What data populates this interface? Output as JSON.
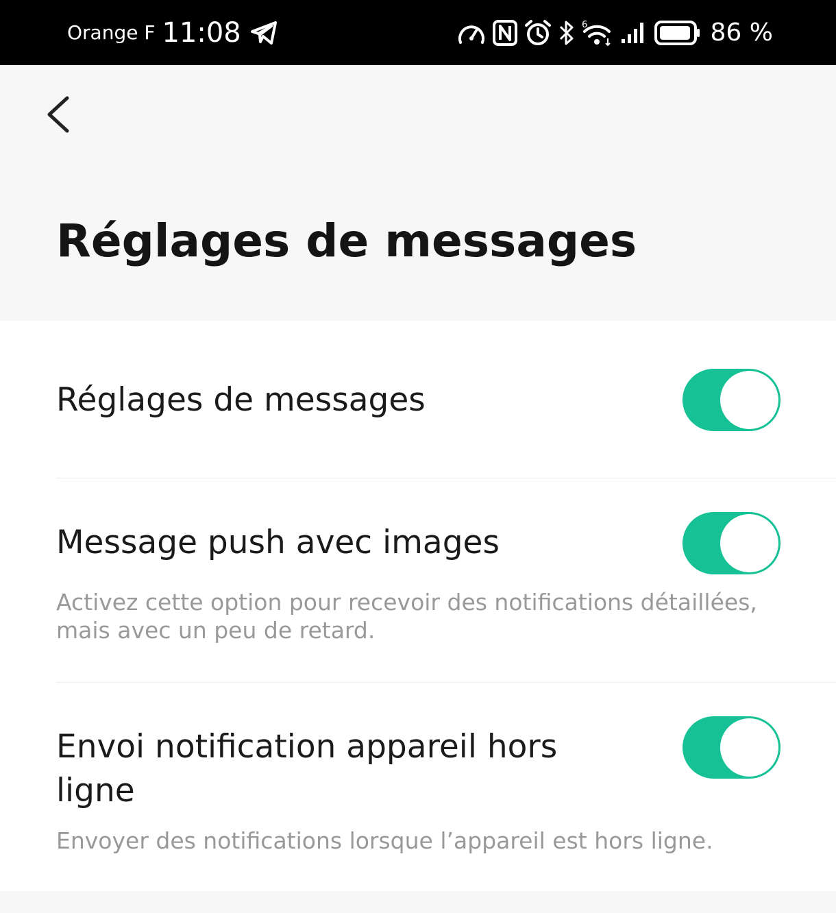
{
  "status_bar": {
    "carrier": "Orange F",
    "time": "11:08",
    "battery_percent": "86 %",
    "icons": [
      "telegram-icon",
      "speedometer-icon",
      "nfc-icon",
      "alarm-icon",
      "bluetooth-icon",
      "wifi-6-icon",
      "signal-icon",
      "battery-icon"
    ]
  },
  "header": {
    "back_icon": "chevron-left-icon",
    "title": "Réglages de messages"
  },
  "settings": [
    {
      "title": "Réglages de messages",
      "description": "",
      "enabled": true
    },
    {
      "title": "Message push avec images",
      "description": "Activez cette option pour recevoir des notifications détaillées, mais avec un peu de retard.",
      "enabled": true
    },
    {
      "title_line1": "Envoi notification appareil hors",
      "title_line2": "ligne",
      "description": "Envoyer des notifications lorsque l’appareil est hors ligne.",
      "enabled": true
    }
  ],
  "colors": {
    "toggle_on": "#16c295",
    "background": "#f7f7f7",
    "card": "#ffffff",
    "description_text": "#999999"
  }
}
